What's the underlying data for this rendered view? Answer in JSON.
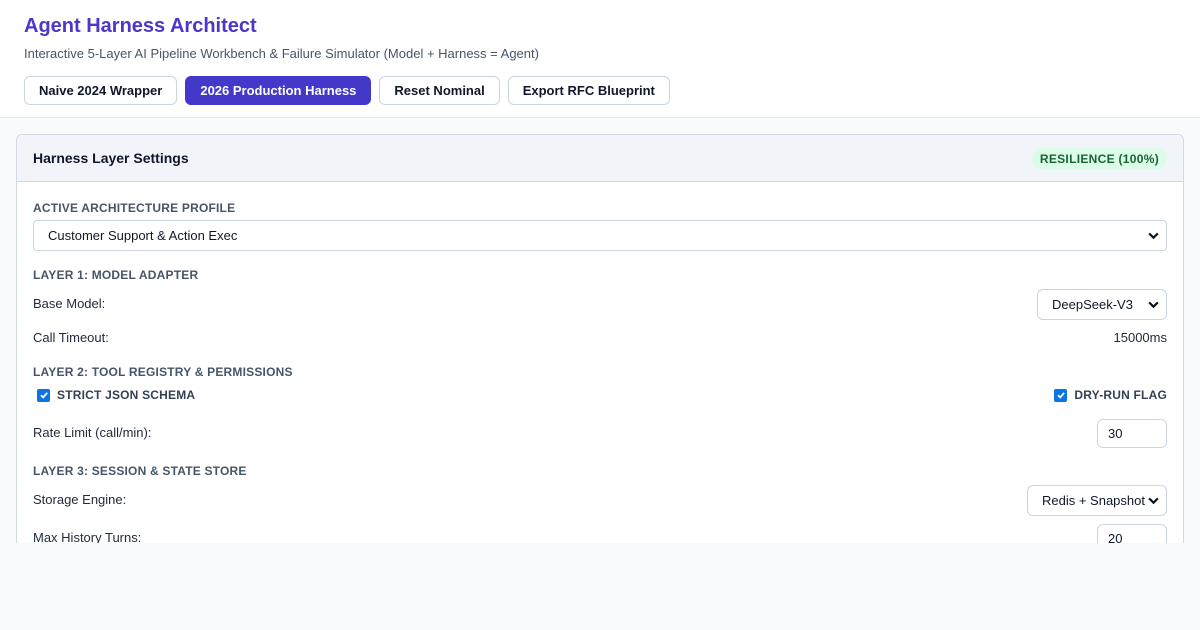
{
  "header": {
    "title": "Agent Harness Architect",
    "subtitle": "Interactive 5-Layer AI Pipeline Workbench & Failure Simulator (Model + Harness = Agent)",
    "buttons": [
      {
        "label": "Naive 2024 Wrapper",
        "active": false
      },
      {
        "label": "2026 Production Harness",
        "active": true
      },
      {
        "label": "Reset Nominal",
        "active": false
      },
      {
        "label": "Export RFC Blueprint",
        "active": false
      }
    ]
  },
  "panel": {
    "title": "Harness Layer Settings",
    "badge": "RESILIENCE (100%)",
    "profile": {
      "label": "ACTIVE ARCHITECTURE PROFILE",
      "value": "Customer Support & Action Exec"
    },
    "layer1": {
      "label": "LAYER 1: MODEL ADAPTER",
      "base_model_label": "Base Model:",
      "base_model_value": "DeepSeek-V3",
      "timeout_label": "Call Timeout:",
      "timeout_value": "15000ms"
    },
    "layer2": {
      "label": "LAYER 2: TOOL REGISTRY & PERMISSIONS",
      "strict_schema_label": "STRICT JSON SCHEMA",
      "strict_schema_checked": true,
      "dry_run_label": "DRY-RUN FLAG",
      "dry_run_checked": true,
      "rate_limit_label": "Rate Limit (call/min):",
      "rate_limit_value": "30"
    },
    "layer3": {
      "label": "LAYER 3: SESSION & STATE STORE",
      "storage_label": "Storage Engine:",
      "storage_value": "Redis + Snapshot",
      "history_label": "Max History Turns:",
      "history_value": "20"
    }
  },
  "colors": {
    "accent": "#4338ca",
    "title": "#4f35c9",
    "badge_bg": "#dcfce7",
    "badge_text": "#166534",
    "checkbox": "#0b74e5"
  }
}
